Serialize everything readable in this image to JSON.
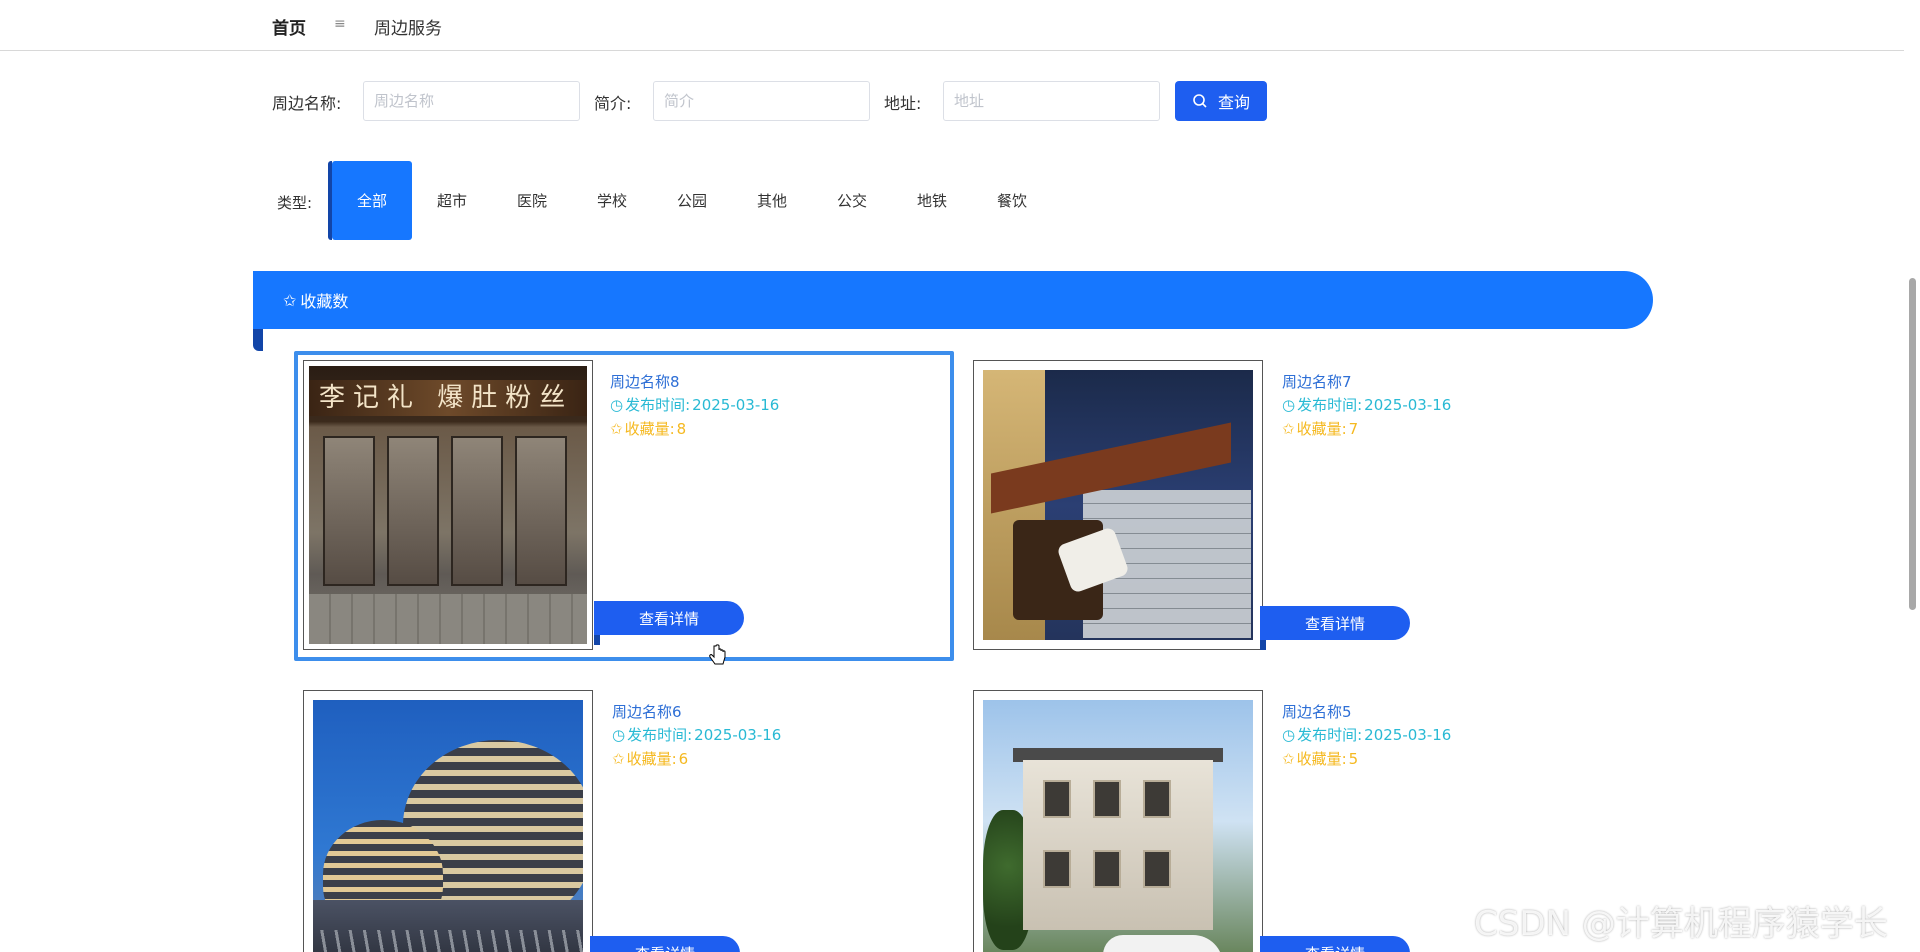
{
  "nav": {
    "home": "首页",
    "separator": "≡",
    "current": "周边服务"
  },
  "search": {
    "name_label": "周边名称:",
    "name_placeholder": "周边名称",
    "name_value": "",
    "intro_label": "简介:",
    "intro_placeholder": "简介",
    "intro_value": "",
    "address_label": "地址:",
    "address_placeholder": "地址",
    "address_value": "",
    "button_label": "查询"
  },
  "types": {
    "label": "类型:",
    "items": [
      "全部",
      "超市",
      "医院",
      "学校",
      "公园",
      "其他",
      "公交",
      "地铁",
      "餐饮"
    ],
    "active": "全部"
  },
  "section": {
    "title": "收藏数"
  },
  "cards": [
    {
      "title": "周边名称8",
      "time_label": "发布时间:",
      "time": "2025-03-16",
      "fav_label": "收藏量:",
      "fav": "8",
      "button": "查看详情",
      "sign": "李记礼  爆肚粉丝"
    },
    {
      "title": "周边名称7",
      "time_label": "发布时间:",
      "time": "2025-03-16",
      "fav_label": "收藏量:",
      "fav": "7",
      "button": "查看详情"
    },
    {
      "title": "周边名称6",
      "time_label": "发布时间:",
      "time": "2025-03-16",
      "fav_label": "收藏量:",
      "fav": "6",
      "button": "查看详情"
    },
    {
      "title": "周边名称5",
      "time_label": "发布时间:",
      "time": "2025-03-16",
      "fav_label": "收藏量:",
      "fav": "5",
      "button": "查看详情"
    }
  ],
  "watermark": "CSDN @计算机程序猿学长",
  "colors": {
    "primary": "#1677ff",
    "button": "#1e5ef0",
    "title": "#2e6fd6",
    "time": "#28b9d4",
    "fav": "#f5b921"
  }
}
